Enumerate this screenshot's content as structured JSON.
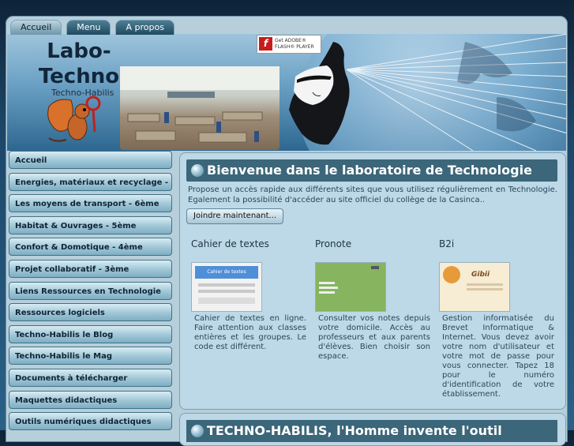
{
  "tabs": [
    {
      "label": "Accueil",
      "active": true
    },
    {
      "label": "Menu",
      "active": false
    },
    {
      "label": "A propos",
      "active": false
    }
  ],
  "header": {
    "title_line1": "Labo-",
    "title_line2": "Techno",
    "subtitle": "Techno-Habilis",
    "flash_badge": {
      "line1": "Get ADOBE®",
      "line2": "FLASH® PLAYER"
    }
  },
  "sidebar": {
    "items": [
      {
        "label": "Accueil"
      },
      {
        "label": "Energies, matériaux et recyclage -"
      },
      {
        "label": "Les moyens de transport - 6ème"
      },
      {
        "label": "Habitat & Ouvrages - 5ème"
      },
      {
        "label": "Confort & Domotique - 4ème"
      },
      {
        "label": "Projet collaboratif - 3ème"
      },
      {
        "label": "Liens Ressources en Technologie"
      },
      {
        "label": "Ressources logiciels"
      },
      {
        "label": "Techno-Habilis le Blog"
      },
      {
        "label": "Techno-Habilis le Mag"
      },
      {
        "label": "Documents à télécharger"
      },
      {
        "label": "Maquettes didactiques"
      },
      {
        "label": "Outils numériques didactiques"
      }
    ]
  },
  "main": {
    "title": "Bienvenue dans le laboratoire de Technologie",
    "intro": "Propose un accès rapide aux différents sites que vous utilisez régulièrement en Technologie. Egalement la possibilité d'accéder au site officiel du collège de la Casinca..",
    "join_button": "Joindre maintenant...",
    "columns": [
      {
        "title": "Cahier de textes",
        "thumb_caption": "Cahier de textes",
        "description": "Cahier de textes en ligne. Faire attention aux classes entières et les groupes. Le code est différent."
      },
      {
        "title": "Pronote",
        "description": "Consulter vos notes depuis votre domicile. Accès au professeurs et aux parents d'élèves. Bien choisir son espace."
      },
      {
        "title": "B2i",
        "thumb_caption": "Gibii",
        "description": "Gestion informatisée du Brevet Informatique & Internet. Vous devez avoir votre nom d'utilisateur et votre mot de passe pour vous connecter. Tapez 18 pour le numéro d'identification de votre établissement."
      }
    ],
    "second_title": "TECHNO-HABILIS, l'Homme invente l'outil"
  },
  "colors": {
    "panel_head": "#3c6679",
    "panel_bg": "#bdd8e6",
    "sidebar_button": "#9fc6d6"
  }
}
